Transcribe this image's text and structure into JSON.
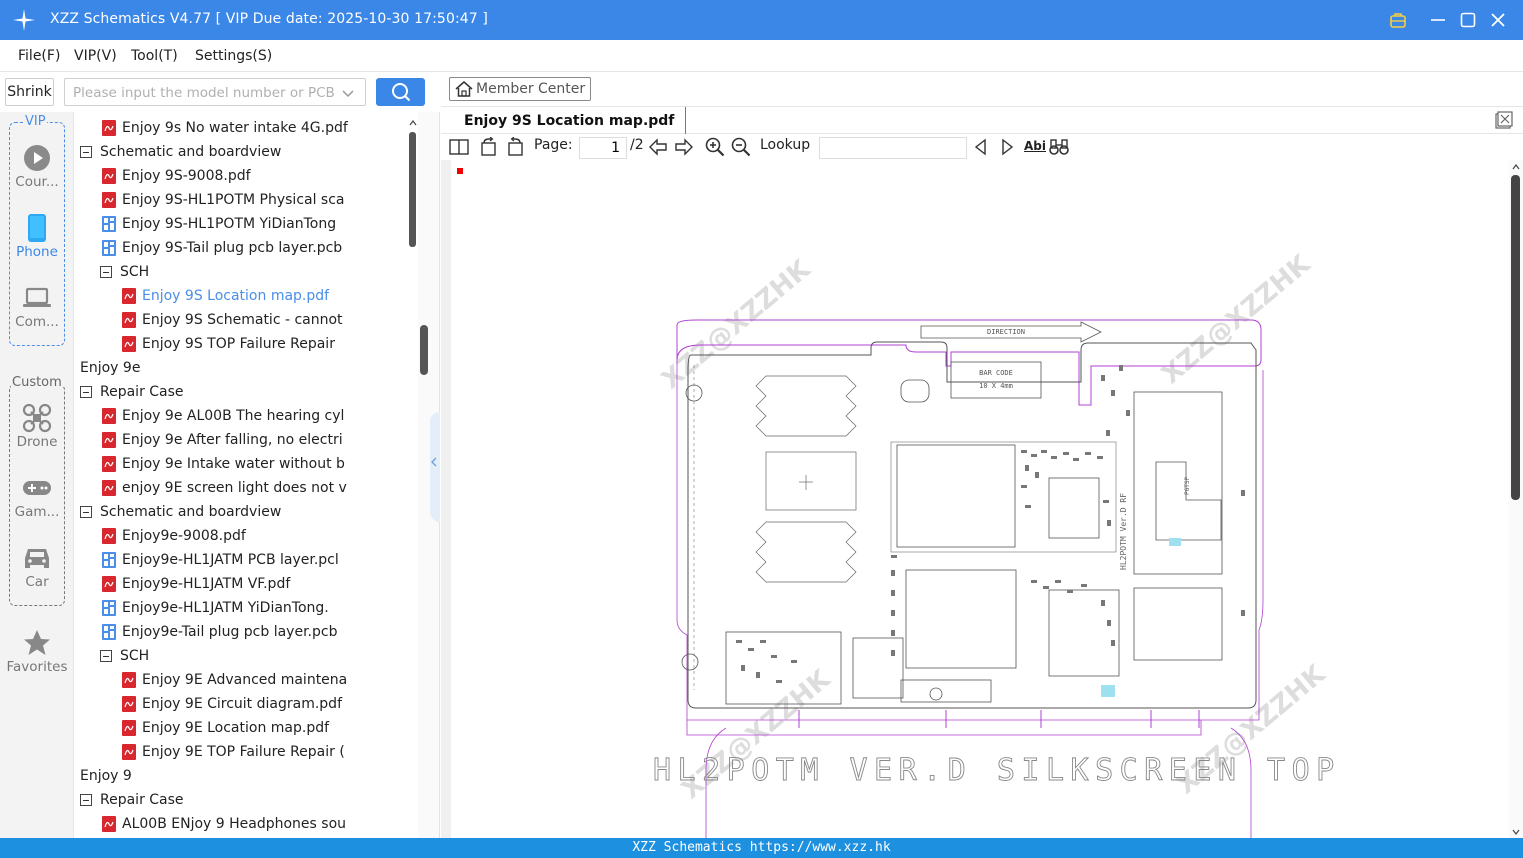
{
  "app": {
    "title": "XZZ Schematics V4.77 [ VIP Due date: 2025-10-30 17:50:47 ]",
    "accent": "#3b87e8"
  },
  "menu": [
    "File(F)",
    "VIP(V)",
    "Tool(T)",
    "Settings(S)"
  ],
  "search": {
    "shrink_label": "Shrink",
    "placeholder": "Please input the model number or PCB"
  },
  "sidebar": {
    "vip_title": "VIP",
    "custom_title": "Custom",
    "items": [
      {
        "label": "Cour...",
        "icon": "play-circle-icon"
      },
      {
        "label": "Phone",
        "icon": "phone-icon"
      },
      {
        "label": "Com...",
        "icon": "laptop-icon"
      },
      {
        "label": "Drone",
        "icon": "drone-icon"
      },
      {
        "label": "Gam...",
        "icon": "gamepad-icon"
      },
      {
        "label": "Car",
        "icon": "car-icon"
      },
      {
        "label": "Favorites",
        "icon": "star-icon"
      }
    ]
  },
  "tree": [
    {
      "label": "Enjoy 9s No water intake 4G.pdf",
      "level": 3,
      "type": "pdf"
    },
    {
      "label": "Schematic and boardview",
      "level": 2,
      "type": "folder"
    },
    {
      "label": "Enjoy 9S-9008.pdf",
      "level": 3,
      "type": "pdf"
    },
    {
      "label": "Enjoy 9S-HL1POTM Physical sca",
      "level": 3,
      "type": "pdf"
    },
    {
      "label": "Enjoy 9S-HL1POTM YiDianTong",
      "level": 3,
      "type": "pcb"
    },
    {
      "label": "Enjoy 9S-Tail plug pcb layer.pcb",
      "level": 3,
      "type": "pcb"
    },
    {
      "label": "SCH",
      "level": 3,
      "type": "folder"
    },
    {
      "label": "Enjoy 9S Location map.pdf",
      "level": 4,
      "type": "pdf",
      "selected": true
    },
    {
      "label": "Enjoy 9S Schematic - cannot",
      "level": 4,
      "type": "pdf"
    },
    {
      "label": "Enjoy 9S TOP  Failure Repair",
      "level": 4,
      "type": "pdf"
    },
    {
      "label": "Enjoy 9e",
      "level": 1,
      "type": "folder"
    },
    {
      "label": "Repair Case",
      "level": 2,
      "type": "folder"
    },
    {
      "label": "Enjoy 9e AL00B The hearing cyl",
      "level": 3,
      "type": "pdf"
    },
    {
      "label": "Enjoy 9e After falling, no electri",
      "level": 3,
      "type": "pdf"
    },
    {
      "label": "Enjoy 9e Intake water without b",
      "level": 3,
      "type": "pdf"
    },
    {
      "label": "enjoy 9E screen light does not v",
      "level": 3,
      "type": "pdf"
    },
    {
      "label": "Schematic and boardview",
      "level": 2,
      "type": "folder"
    },
    {
      "label": "Enjoy9e-9008.pdf",
      "level": 3,
      "type": "pdf"
    },
    {
      "label": "Enjoy9e-HL1JATM PCB layer.pcl",
      "level": 3,
      "type": "pcb"
    },
    {
      "label": "Enjoy9e-HL1JATM VF.pdf",
      "level": 3,
      "type": "pdf"
    },
    {
      "label": "Enjoy9e-HL1JATM YiDianTong.",
      "level": 3,
      "type": "pcb"
    },
    {
      "label": "Enjoy9e-Tail plug pcb layer.pcb",
      "level": 3,
      "type": "pcb"
    },
    {
      "label": "SCH",
      "level": 3,
      "type": "folder"
    },
    {
      "label": "Enjoy 9E Advanced maintena",
      "level": 4,
      "type": "pdf"
    },
    {
      "label": "Enjoy 9E Circuit diagram.pdf",
      "level": 4,
      "type": "pdf"
    },
    {
      "label": "Enjoy 9E Location map.pdf",
      "level": 4,
      "type": "pdf"
    },
    {
      "label": "Enjoy 9E TOP Failure Repair (",
      "level": 4,
      "type": "pdf"
    },
    {
      "label": "Enjoy 9",
      "level": 1,
      "type": "folder"
    },
    {
      "label": "Repair Case",
      "level": 2,
      "type": "folder"
    },
    {
      "label": "AL00B ENjoy 9 Headphones sou",
      "level": 3,
      "type": "pdf"
    }
  ],
  "viewer": {
    "member_center": "Member Center",
    "tab_label": "Enjoy 9S Location map.pdf",
    "page_label": "Page:",
    "page_current": "1",
    "page_total": "/2",
    "lookup_label": "Lookup",
    "abi_label": "Abi"
  },
  "drawing": {
    "direction": "DIRECTION",
    "barcode1": "BAR CODE",
    "barcode2": "10 X 4mm",
    "silkscreen": "HL2POTM VER.D SILKSCREEN TOP",
    "side_label": "HL2POTM Ver.D RF",
    "watermark": "XZZ@XZZHK",
    "pn_label": "PGTSP"
  },
  "status": "XZZ Schematics https://www.xzz.hk"
}
